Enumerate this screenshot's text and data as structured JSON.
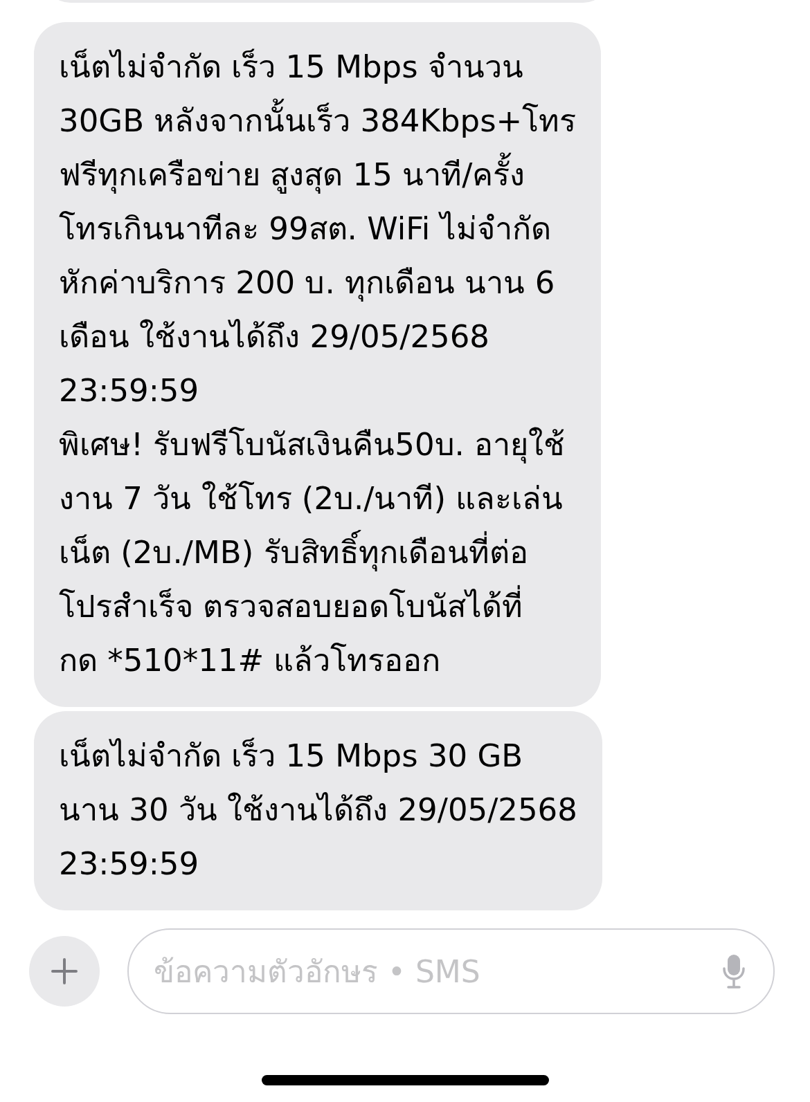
{
  "messages": [
    {
      "text": "เน็ตไม่จำกัด เร็ว 15 Mbps จำนวน\n30GB หลังจากนั้นเร็ว 384Kbps+โทร\nฟรีทุกเครือข่าย สูงสุด 15 นาที/ครั้ง\nโทรเกินนาทีละ 99สต. WiFi ไม่จำกัด\nหักค่าบริการ 200 บ. ทุกเดือน นาน 6\nเดือน ใช้งานได้ถึง 29/05/2568\n23:59:59\nพิเศษ! รับฟรีโบนัสเงินคืน50บ. อายุใช้\nงาน 7 วัน ใช้โทร (2บ./นาที) และเล่น\nเน็ต (2บ./MB) รับสิทธิ์ทุกเดือนที่ต่อ\nโปรสำเร็จ ตรวจสอบยอดโบนัสได้ที่\nกด *510*11# แล้วโทรออก"
    },
    {
      "text": "เน็ตไม่จำกัด เร็ว 15 Mbps 30 GB\nนาน 30 วัน ใช้งานได้ถึง 29/05/2568\n23:59:59"
    }
  ],
  "composer": {
    "placeholder": "ข้อความตัวอักษร • SMS"
  }
}
